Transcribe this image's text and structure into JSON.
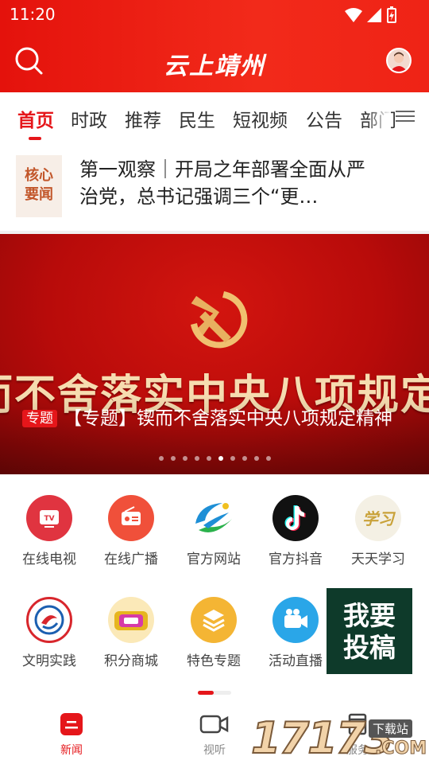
{
  "status_bar": {
    "time": "11:20"
  },
  "header": {
    "title": "云上靖州"
  },
  "tabs": [
    {
      "label": "首页",
      "active": true
    },
    {
      "label": "时政"
    },
    {
      "label": "推荐"
    },
    {
      "label": "民生"
    },
    {
      "label": "短视频"
    },
    {
      "label": "公告"
    },
    {
      "label": "部门"
    }
  ],
  "headline": {
    "badge_line1": "核心",
    "badge_line2": "要闻",
    "text": "第一观察｜开局之年部署全面从严治党，总书记强调三个“更…"
  },
  "banner": {
    "big_text": "而不舍落实中央八项规定精",
    "tag": "专题",
    "caption": "【专题】锲而不舍落实中央八项规定精神",
    "slide_count": 10,
    "active_slide": 5
  },
  "services": [
    {
      "label": "在线电视",
      "icon": "tv-icon",
      "color": "#e03440"
    },
    {
      "label": "在线广播",
      "icon": "radio-icon",
      "color": "#f0503a"
    },
    {
      "label": "官方网站",
      "icon": "website-logo-icon",
      "color": "#1e8fd6"
    },
    {
      "label": "官方抖音",
      "icon": "douyin-icon",
      "color": "#111111"
    },
    {
      "label": "天天学习",
      "icon": "study-icon",
      "color": "#c9a23a"
    },
    {
      "label": "文明实践",
      "icon": "civilization-icon",
      "color": "#d8262c"
    },
    {
      "label": "积分商城",
      "icon": "points-mall-icon",
      "color": "#e7b51e"
    },
    {
      "label": "特色专题",
      "icon": "layers-icon",
      "color": "#f4b534"
    },
    {
      "label": "活动直播",
      "icon": "live-camera-icon",
      "color": "#2aa6e8"
    }
  ],
  "submit": {
    "line1": "我要",
    "line2": "投稿"
  },
  "bottom_nav": [
    {
      "label": "新闻",
      "icon": "news-icon",
      "active": true
    },
    {
      "label": "视听",
      "icon": "video-icon"
    },
    {
      "label": "服务",
      "icon": "service-icon"
    }
  ],
  "watermark": {
    "text": "17173",
    "tag": "下载站",
    "domain": ".COM"
  },
  "colors": {
    "brand_red": "#e5161a",
    "submit_bg": "#0e3a2a"
  }
}
